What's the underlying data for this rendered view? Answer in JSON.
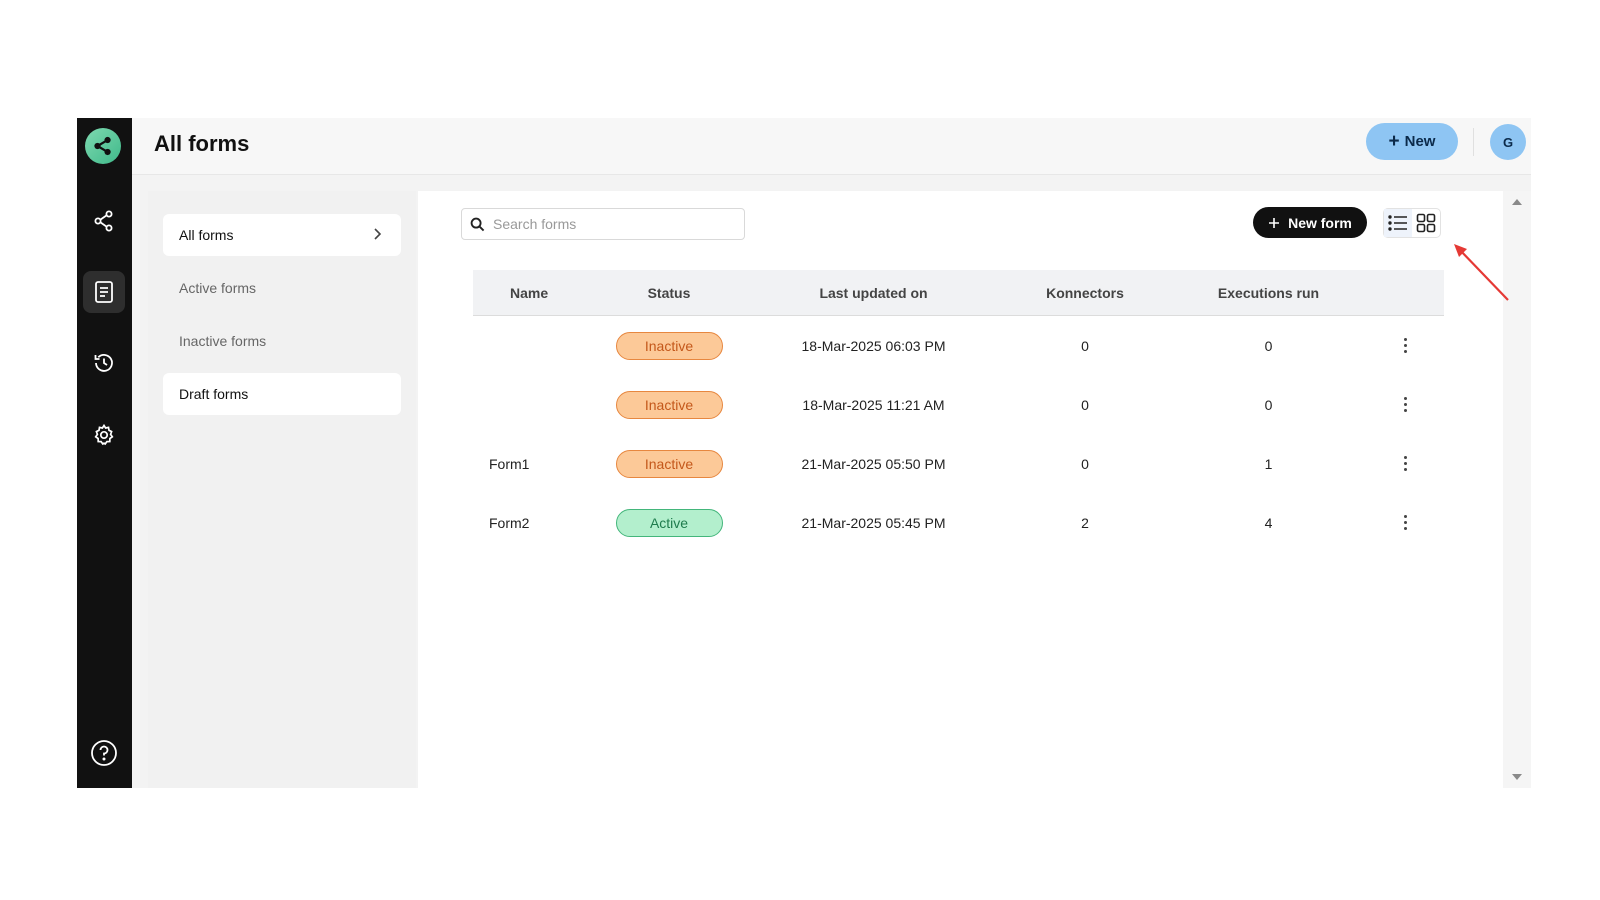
{
  "header": {
    "title": "All forms",
    "new_label": "New",
    "new_icon": "plus-icon",
    "avatar_initial": "G"
  },
  "rail": {
    "logo": "share-logo-icon",
    "items": [
      {
        "icon": "share-icon"
      },
      {
        "icon": "forms-icon",
        "active": true
      },
      {
        "icon": "history-icon"
      },
      {
        "icon": "settings-icon"
      }
    ],
    "help_icon": "help-icon"
  },
  "subnav": {
    "items": [
      {
        "label": "All forms"
      },
      {
        "label": "Active forms"
      },
      {
        "label": "Inactive forms"
      },
      {
        "label": "Draft forms"
      }
    ]
  },
  "search": {
    "placeholder": "Search forms"
  },
  "toolbar": {
    "new_form_label": "New form"
  },
  "table": {
    "columns": [
      "Name",
      "Status",
      "Last updated on",
      "Konnectors",
      "Executions run"
    ],
    "rows": [
      {
        "name": "",
        "status": "Inactive",
        "updated": "18-Mar-2025 06:03 PM",
        "konnectors": "0",
        "executions": "0"
      },
      {
        "name": "",
        "status": "Inactive",
        "updated": "18-Mar-2025 11:21 AM",
        "konnectors": "0",
        "executions": "0"
      },
      {
        "name": "Form1",
        "status": "Inactive",
        "updated": "21-Mar-2025 05:50 PM",
        "konnectors": "0",
        "executions": "1"
      },
      {
        "name": "Form2",
        "status": "Active",
        "updated": "21-Mar-2025 05:45 PM",
        "konnectors": "2",
        "executions": "4"
      }
    ]
  },
  "colors": {
    "rail": "#111111",
    "accent_blue": "#8ec5f3",
    "inactive_bg": "#fcc998",
    "active_bg": "#b3efcd",
    "annotation_arrow": "#e53935"
  }
}
